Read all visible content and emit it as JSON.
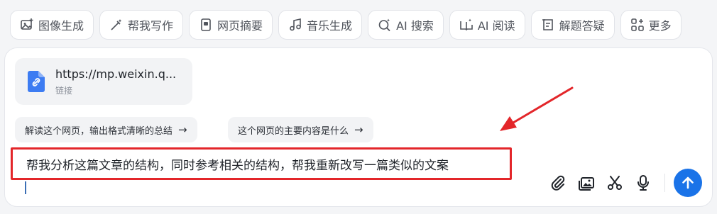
{
  "toolbar": {
    "items": [
      {
        "label": "图像生成",
        "icon": "image-plus-icon"
      },
      {
        "label": "帮我写作",
        "icon": "magic-pen-icon"
      },
      {
        "label": "网页摘要",
        "icon": "document-icon"
      },
      {
        "label": "音乐生成",
        "icon": "music-note-icon"
      },
      {
        "label": "AI 搜索",
        "icon": "search-sparkle-icon"
      },
      {
        "label": "AI 阅读",
        "icon": "book-sparkle-icon"
      },
      {
        "label": "解题答疑",
        "icon": "question-doc-icon"
      },
      {
        "label": "更多",
        "icon": "grid-plus-icon"
      }
    ]
  },
  "attachment": {
    "url": "https://mp.weixin.q...",
    "type_label": "链接",
    "icon": "link-file-icon"
  },
  "suggestions": [
    {
      "label": "解读这个网页，输出格式清晰的总结",
      "arrow": "→"
    },
    {
      "label": "这个网页的主要内容是什么",
      "arrow": "→"
    }
  ],
  "input": {
    "text": "帮我分析这篇文章的结构，同时参考相关的结构，帮我重新改写一篇类似的文案"
  },
  "actions": {
    "attach_icon": "paperclip-icon",
    "image_icon": "image-upload-icon",
    "scissors_icon": "scissors-icon",
    "mic_icon": "microphone-icon",
    "send_icon": "send-arrow-icon"
  },
  "colors": {
    "accent": "#1a73e8",
    "highlight_border": "#e3262a",
    "file_icon": "#3d7cf2"
  }
}
